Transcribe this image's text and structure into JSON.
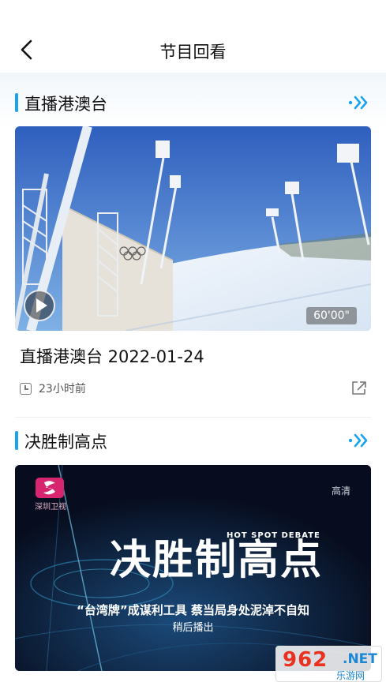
{
  "header": {
    "title": "节目回看"
  },
  "sections": [
    {
      "title": "直播港澳台",
      "item": {
        "title": "直播港澳台 2022-01-24",
        "duration": "60'00\"",
        "time_ago": "23小时前"
      }
    },
    {
      "title": "决胜制高点",
      "thumb": {
        "channel_logo_text": "深圳卫视",
        "quality_badge": "高清",
        "show_title": "决胜制高点",
        "show_title_en": "HOT SPOT DEBATE",
        "subtitle": "“台湾牌”成谋利工具 蔡当局身处泥淖不自知",
        "status": "稍后播出"
      }
    }
  ],
  "watermark": {
    "number": "962",
    "net": ".NET",
    "sub": "乐游网"
  },
  "icons": {
    "back": "chevron-left-icon",
    "more": "double-chevron-right-icon",
    "share": "share-icon",
    "clock": "clock-icon",
    "play": "play-icon"
  },
  "colors": {
    "accent": "#1aa3ef"
  }
}
